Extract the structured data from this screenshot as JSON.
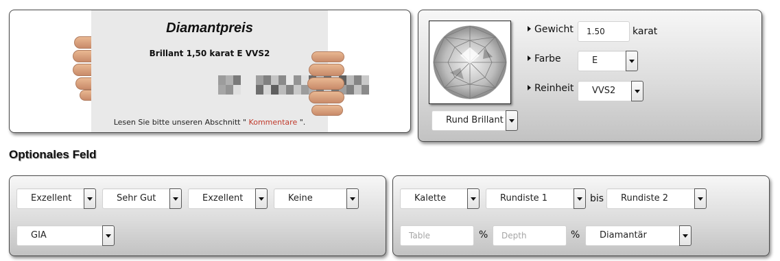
{
  "price_panel": {
    "title": "Diamantpreis",
    "subtitle": "Brillant 1,50 karat E VVS2",
    "note_prefix": "Lesen Sie bitte unseren Abschnitt \" ",
    "note_link": "Kommentare",
    "note_suffix": " \"."
  },
  "diamond": {
    "shape_select": "Rund Brillant",
    "weight_label": "Gewicht",
    "weight_value": "1.50",
    "weight_unit": "karat",
    "color_label": "Farbe",
    "color_value": "E",
    "clarity_label": "Reinheit",
    "clarity_value": "VVS2"
  },
  "optional": {
    "heading": "Optionales Feld",
    "left": {
      "cut": "Exzellent",
      "polish": "Sehr Gut",
      "symmetry": "Exzellent",
      "fluorescence": "Keine",
      "lab": "GIA"
    },
    "right": {
      "culet": "Kalette",
      "girdle_min": "Rundiste 1",
      "between": "bis",
      "girdle_max": "Rundiste 2",
      "table_placeholder": "Table",
      "table_unit": "%",
      "depth_placeholder": "Depth",
      "depth_unit": "%",
      "dealer": "Diamantär"
    }
  }
}
